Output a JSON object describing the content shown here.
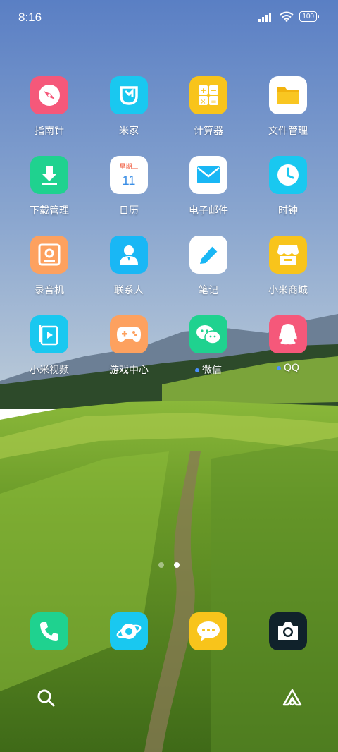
{
  "status_bar": {
    "time": "8:16",
    "battery": "100"
  },
  "apps": [
    {
      "label": "指南针",
      "icon": "compass-icon",
      "color": "#f5587a"
    },
    {
      "label": "米家",
      "icon": "mijia-icon",
      "color": "#19c8f0"
    },
    {
      "label": "计算器",
      "icon": "calculator-icon",
      "color": "#f8c41b"
    },
    {
      "label": "文件管理",
      "icon": "folder-icon",
      "color": "#ffffff"
    },
    {
      "label": "下载管理",
      "icon": "download-icon",
      "color": "#1fd28f"
    },
    {
      "label": "日历",
      "icon": "calendar-icon",
      "color": "#ffffff",
      "weekday": "星期三",
      "day": "11"
    },
    {
      "label": "电子邮件",
      "icon": "mail-icon",
      "color": "#ffffff"
    },
    {
      "label": "时钟",
      "icon": "clock-icon",
      "color": "#19c8f0"
    },
    {
      "label": "录音机",
      "icon": "recorder-icon",
      "color": "#fda15f"
    },
    {
      "label": "联系人",
      "icon": "contacts-icon",
      "color": "#19b7f5"
    },
    {
      "label": "笔记",
      "icon": "notes-icon",
      "color": "#ffffff"
    },
    {
      "label": "小米商城",
      "icon": "store-icon",
      "color": "#f8c41b"
    },
    {
      "label": "小米视频",
      "icon": "video-icon",
      "color": "#19c8f0"
    },
    {
      "label": "游戏中心",
      "icon": "gamepad-icon",
      "color": "#fda15f"
    },
    {
      "label": "微信",
      "icon": "wechat-icon",
      "color": "#1fd28f",
      "badge": true
    },
    {
      "label": "QQ",
      "icon": "qq-icon",
      "color": "#f5587a",
      "badge": true
    }
  ],
  "dock": [
    {
      "name": "phone",
      "icon": "phone-icon",
      "color": "#1fd28f"
    },
    {
      "name": "browser",
      "icon": "browser-icon",
      "color": "#19c8f0"
    },
    {
      "name": "messages",
      "icon": "messages-icon",
      "color": "#f8c41b"
    },
    {
      "name": "camera",
      "icon": "camera-icon",
      "color": "#10222b"
    }
  ],
  "pages": {
    "count": 2,
    "current": 2
  },
  "bottom": {
    "left": "search-icon",
    "right": "app-vault-icon"
  }
}
